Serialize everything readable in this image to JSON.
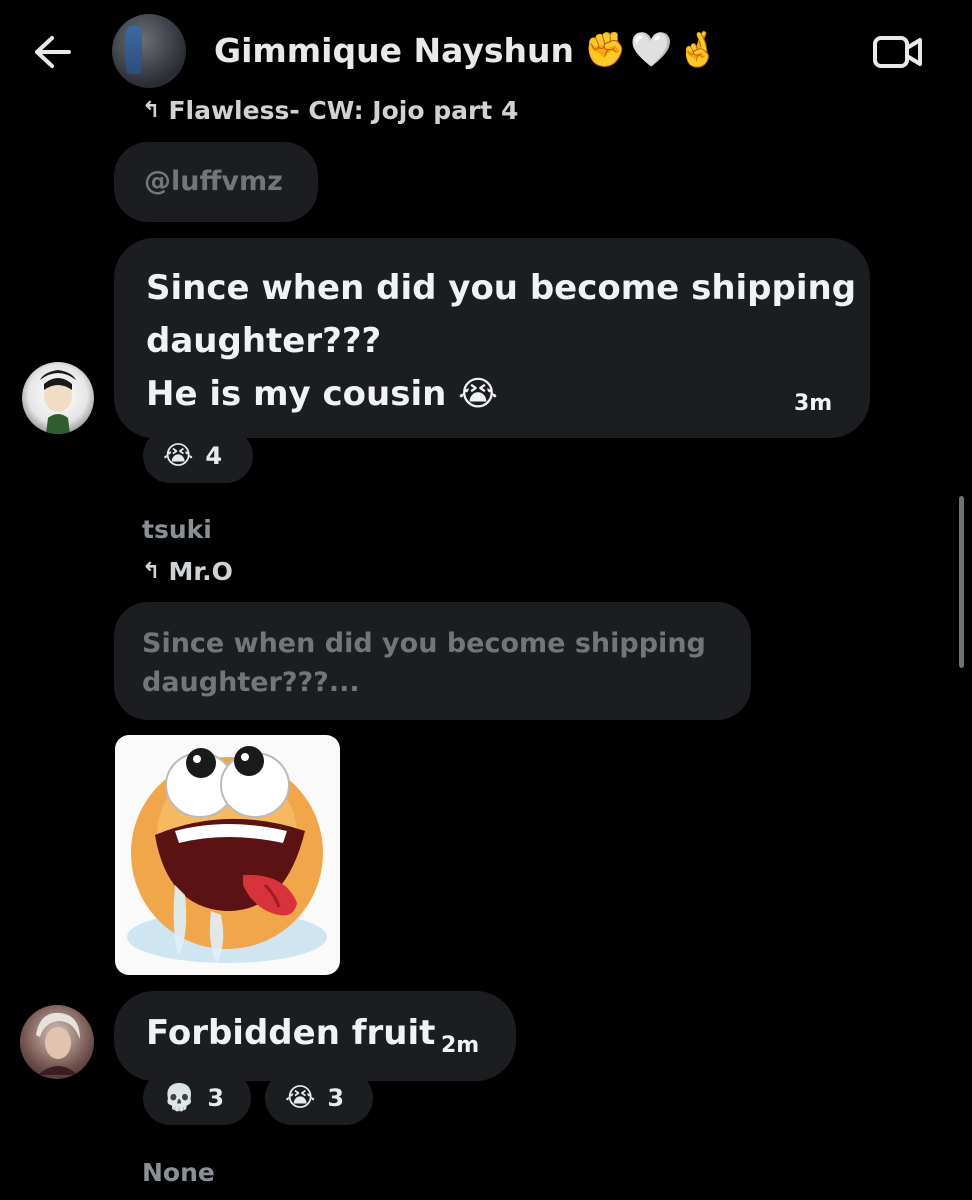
{
  "header": {
    "title": "Gimmique Nayshun",
    "title_emojis": "✊🤍🤞",
    "back_icon": "arrow-left-icon",
    "video_icon": "video-camera-icon"
  },
  "messages": [
    {
      "reply_to_author": "Flawless- CW: Jojo part 4",
      "quoted_text": "@luffvmz",
      "line1": "Since when did you become shipping",
      "line2": "daughter???",
      "line3": "He is my cousin 😭",
      "time": "3m",
      "reactions": [
        {
          "emoji": "😭",
          "count": "4"
        }
      ]
    },
    {
      "sender": "tsuki",
      "reply_to_author": "Mr.O",
      "quoted_line1": "Since when did you become shipping",
      "quoted_line2": "daughter???...",
      "sticker": "drooling-emoji-sticker"
    },
    {
      "text": "Forbidden fruit",
      "time": "2m",
      "reactions": [
        {
          "emoji": "💀",
          "count": "3"
        },
        {
          "emoji": "😭",
          "count": "3"
        }
      ]
    },
    {
      "sender": "None"
    }
  ],
  "colors": {
    "background": "#000000",
    "bubble": "#1c1d20",
    "muted_text": "#71767b"
  }
}
